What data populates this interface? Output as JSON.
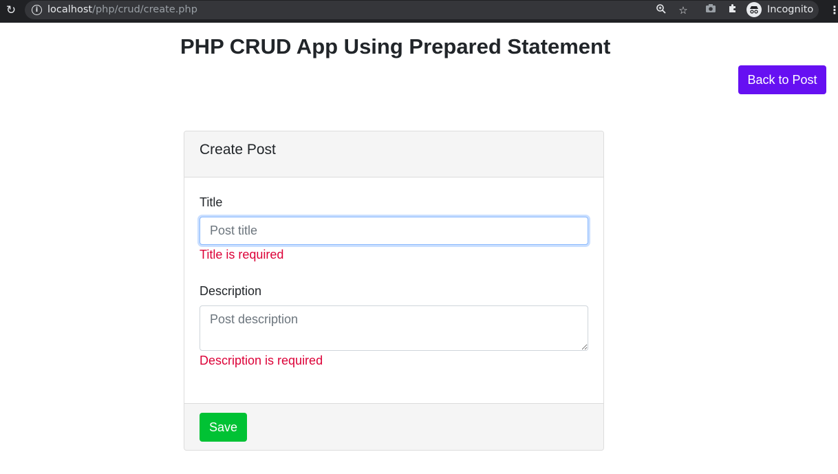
{
  "browser": {
    "url_host": "localhost",
    "url_path": "/php/crud/create.php",
    "incognito_label": "Incognito",
    "icons": [
      "reload-icon",
      "info-icon",
      "zoom-icon",
      "star-icon",
      "camera-icon",
      "extensions-icon",
      "incognito-icon",
      "menu-icon"
    ]
  },
  "page": {
    "title": "PHP CRUD App Using Prepared Statement",
    "back_button": "Back to Post"
  },
  "card": {
    "header": "Create Post",
    "title_label": "Title",
    "title_placeholder": "Post title",
    "title_value": "",
    "title_error": "Title is required",
    "description_label": "Description",
    "description_placeholder": "Post description",
    "description_value": "",
    "description_error": "Description is required",
    "save_button": "Save"
  },
  "colors": {
    "back_button": "#6610f2",
    "save_button": "#00c234",
    "error_text": "#dc0037",
    "focus_border": "#86b7fe"
  }
}
